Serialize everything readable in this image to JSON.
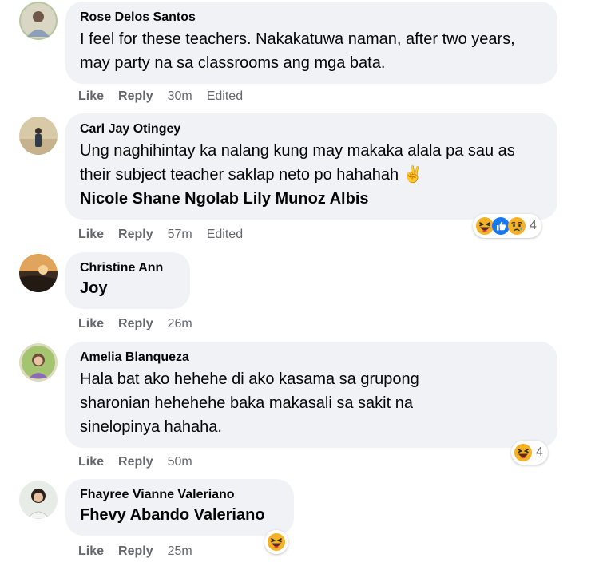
{
  "comments": [
    {
      "author": "Rose Delos Santos",
      "text": "I feel for these teachers. Nakakatuwa naman, after two years, may party na sa classrooms ang mga bata.",
      "like": "Like",
      "reply": "Reply",
      "time": "30m",
      "edited": "Edited"
    },
    {
      "author": "Carl Jay Otingey",
      "text": "Ung naghihintay ka nalang kung may makaka alala pa sau as their subject teacher saklap neto po hahahah ✌️",
      "mention": "Nicole Shane Ngolab Lily Munoz Albis",
      "like": "Like",
      "reply": "Reply",
      "time": "57m",
      "edited": "Edited",
      "reaction_count": "4",
      "reactions": [
        "haha-icon",
        "like-icon",
        "sad-icon"
      ]
    },
    {
      "author": "Christine Ann",
      "mention": "Joy",
      "like": "Like",
      "reply": "Reply",
      "time": "26m"
    },
    {
      "author": "Amelia Blanqueza",
      "text": "Hala bat ako hehehe di ako kasama sa grupong sharonian hehehehe baka makasali sa sakit na sinelopinya hahaha.",
      "like": "Like",
      "reply": "Reply",
      "time": "50m",
      "reaction_count": "4",
      "reactions": [
        "haha-icon"
      ]
    },
    {
      "author": "Fhayree Vianne Valeriano",
      "mention": "Fhevy Abando Valeriano",
      "like": "Like",
      "reply": "Reply",
      "time": "25m",
      "reactions": [
        "haha-icon"
      ]
    }
  ],
  "colors": {
    "bubble": "#f0f2f5",
    "meta_text": "#65676b",
    "like_blue": "#1877f2",
    "haha_yellow": "#f7b125"
  }
}
